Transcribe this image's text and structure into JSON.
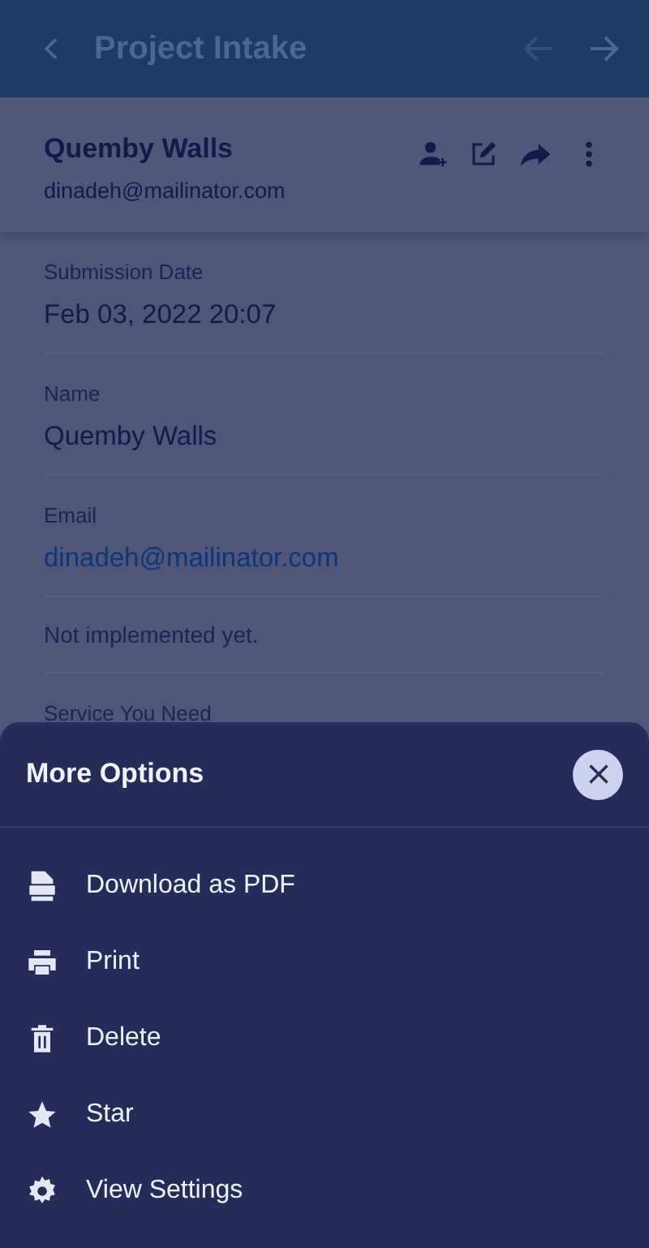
{
  "app_bar": {
    "title": "Project Intake"
  },
  "contact": {
    "name": "Quemby Walls",
    "email": "dinadeh@mailinator.com"
  },
  "fields": [
    {
      "kind": "text",
      "label": "Submission Date",
      "value": "Feb 03, 2022 20:07"
    },
    {
      "kind": "text",
      "label": "Name",
      "value": "Quemby Walls"
    },
    {
      "kind": "link",
      "label": "Email",
      "value": "dinadeh@mailinator.com"
    },
    {
      "kind": "note",
      "value": "Not implemented yet."
    },
    {
      "kind": "label",
      "label": "Service You Need"
    }
  ],
  "sheet": {
    "title": "More Options",
    "items": [
      {
        "kind": "pdf",
        "label": "Download as PDF"
      },
      {
        "kind": "print",
        "label": "Print"
      },
      {
        "kind": "delete",
        "label": "Delete"
      },
      {
        "kind": "star",
        "label": "Star"
      },
      {
        "kind": "settings",
        "label": "View Settings"
      }
    ]
  }
}
